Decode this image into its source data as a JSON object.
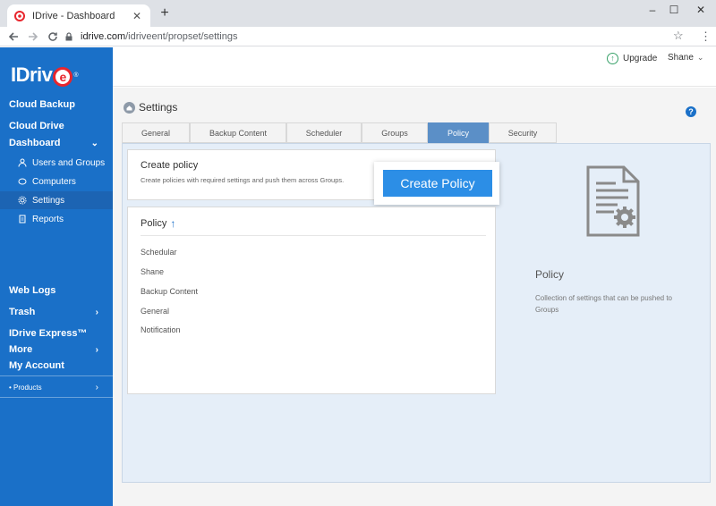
{
  "browser": {
    "tab_title": "IDrive - Dashboard",
    "new_tab": "+",
    "minimize": "–",
    "maximize": "☐",
    "close": "✕",
    "url_host": "idrive.com",
    "url_path": "/idriveent/propset/settings"
  },
  "sidebar": {
    "logo_text": "IDriv",
    "logo_e": "e",
    "logo_reg": "®",
    "items": [
      {
        "label": "Cloud Backup"
      },
      {
        "label": "Cloud Drive"
      },
      {
        "label": "Dashboard"
      },
      {
        "label": "Web Logs"
      },
      {
        "label": "Trash"
      },
      {
        "label": "IDrive Express™"
      },
      {
        "label": "More"
      },
      {
        "label": "My Account"
      }
    ],
    "sub_items": [
      {
        "label": "Users and Groups",
        "icon": "users-icon"
      },
      {
        "label": "Computers",
        "icon": "computers-icon"
      },
      {
        "label": "Settings",
        "icon": "gear-icon"
      },
      {
        "label": "Reports",
        "icon": "reports-icon"
      }
    ],
    "products": "• Products",
    "chevron_down": "⌄",
    "chevron_right": "›"
  },
  "header": {
    "upgrade": "Upgrade",
    "user": "Shane",
    "user_caret": "⌄"
  },
  "settings": {
    "title": "Settings",
    "help": "?",
    "tabs": [
      "General",
      "Backup Content",
      "Scheduler",
      "Groups",
      "Policy",
      "Security"
    ],
    "active_tab": "Policy"
  },
  "create_policy": {
    "heading": "Create policy",
    "description": "Create policies with required settings and push them across Groups.",
    "button": "Create Policy"
  },
  "policy_list": {
    "heading": "Policy",
    "sort_icon": "↑",
    "items": [
      "Schedular",
      "Shane",
      "Backup Content",
      "General",
      "Notification"
    ]
  },
  "info": {
    "heading": "Policy",
    "description": "Collection of settings that can be pushed to Groups"
  },
  "colors": {
    "sidebar": "#1a70c8",
    "accent": "#2c8ee6",
    "active_tab": "#5b8fc7",
    "panel": "#e5eef8"
  }
}
